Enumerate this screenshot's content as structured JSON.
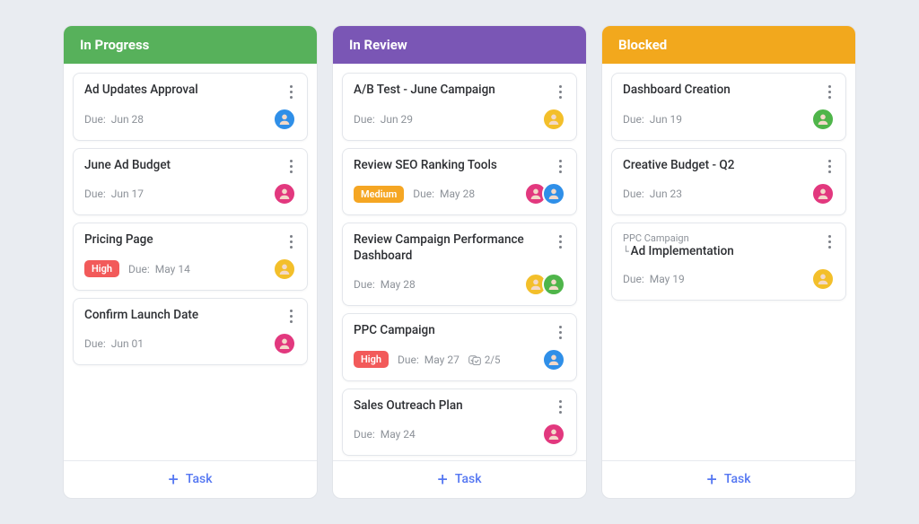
{
  "add_task_label": "Task",
  "due_prefix": "Due:",
  "priority_labels": {
    "high": "High",
    "medium": "Medium"
  },
  "avatar_colors": {
    "blue": "#2f8fe8",
    "pink": "#e2387e",
    "yellow": "#f3bf2a",
    "green": "#4fb54a"
  },
  "columns": [
    {
      "title": "In Progress",
      "color": "#57b15b",
      "cards": [
        {
          "title": "Ad Updates Approval",
          "due": "Jun 28",
          "avatars": [
            "blue"
          ]
        },
        {
          "title": "June Ad Budget",
          "due": "Jun 17",
          "avatars": [
            "pink"
          ]
        },
        {
          "title": "Pricing Page",
          "priority": "high",
          "due": "May 14",
          "avatars": [
            "yellow"
          ]
        },
        {
          "title": "Confirm Launch Date",
          "due": "Jun 01",
          "avatars": [
            "pink"
          ]
        }
      ]
    },
    {
      "title": "In Review",
      "color": "#7a56b5",
      "cards": [
        {
          "title": "A/B Test - June Campaign",
          "due": "Jun 29",
          "avatars": [
            "yellow"
          ]
        },
        {
          "title": "Review SEO Ranking Tools",
          "priority": "medium",
          "due": "May 28",
          "avatars": [
            "pink",
            "blue"
          ]
        },
        {
          "title": "Review Campaign Performance Dashboard",
          "due": "May 28",
          "avatars": [
            "yellow",
            "green"
          ]
        },
        {
          "title": "PPC Campaign",
          "priority": "high",
          "due": "May 27",
          "checklist": "2/5",
          "avatars": [
            "blue"
          ]
        },
        {
          "title": "Sales Outreach Plan",
          "due": "May 24",
          "avatars": [
            "pink"
          ]
        }
      ]
    },
    {
      "title": "Blocked",
      "color": "#f2a81d",
      "cards": [
        {
          "title": "Dashboard Creation",
          "due": "Jun 19",
          "avatars": [
            "green"
          ]
        },
        {
          "title": "Creative Budget - Q2",
          "due": "Jun 23",
          "avatars": [
            "pink"
          ]
        },
        {
          "parent": "PPC Campaign",
          "title": "Ad Implementation",
          "due": "May 19",
          "avatars": [
            "yellow"
          ]
        }
      ]
    }
  ]
}
